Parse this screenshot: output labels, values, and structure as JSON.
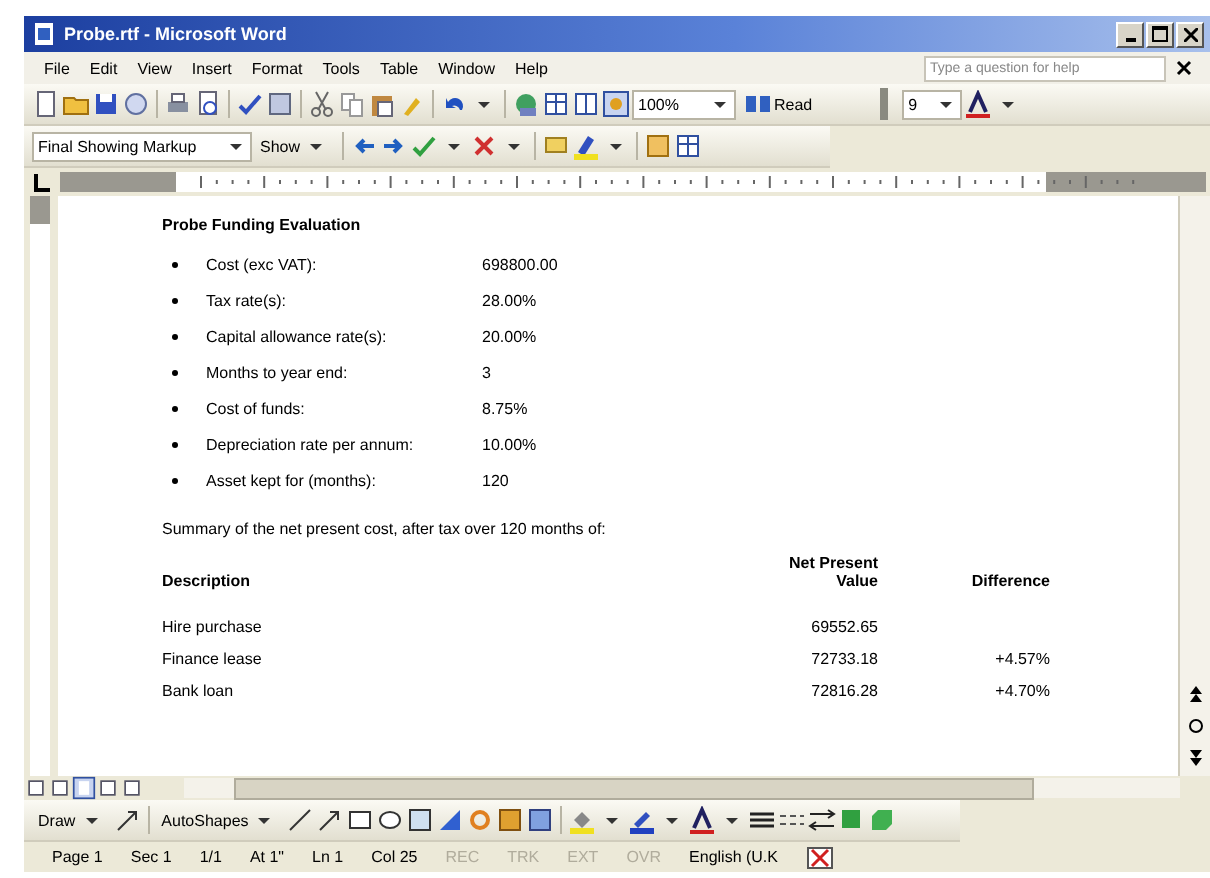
{
  "window": {
    "title": "Probe.rtf - Microsoft Word"
  },
  "menu": [
    {
      "label": "File"
    },
    {
      "label": "Edit"
    },
    {
      "label": "View"
    },
    {
      "label": "Insert"
    },
    {
      "label": "Format"
    },
    {
      "label": "Tools"
    },
    {
      "label": "Table"
    },
    {
      "label": "Window"
    },
    {
      "label": "Help"
    }
  ],
  "help_search": {
    "placeholder": "Type a question for help"
  },
  "standard_toolbar": {
    "zoom": "100%",
    "read": "Read",
    "font_size": "9"
  },
  "reviewing_toolbar": {
    "display": "Final Showing Markup",
    "show": "Show"
  },
  "document": {
    "heading": "Probe Funding Evaluation",
    "bullets": [
      {
        "label": "Cost (exc VAT):",
        "value": "698800.00"
      },
      {
        "label": "Tax rate(s):",
        "value": "28.00%"
      },
      {
        "label": "Capital allowance rate(s):",
        "value": "20.00%"
      },
      {
        "label": "Months to year end:",
        "value": "3"
      },
      {
        "label": "Cost of funds:",
        "value": "8.75%"
      },
      {
        "label": "Depreciation rate per annum:",
        "value": "10.00%"
      },
      {
        "label": "Asset kept for (months):",
        "value": "120"
      }
    ],
    "summary": "Summary of the net present cost, after tax over 120 months of:",
    "table": {
      "columns": [
        "Description",
        "Net Present Value",
        "Difference"
      ],
      "rows": [
        [
          "Hire purchase",
          "69552.65",
          ""
        ],
        [
          "Finance lease",
          "72733.18",
          "+4.57%"
        ],
        [
          "Bank loan",
          "72816.28",
          "+4.70%"
        ]
      ]
    }
  },
  "drawing_toolbar": {
    "draw": "Draw",
    "autoshapes": "AutoShapes"
  },
  "status_bar": [
    {
      "text": "Page 1",
      "disabled": false
    },
    {
      "text": "Sec 1",
      "disabled": false
    },
    {
      "text": "1/1",
      "disabled": false
    },
    {
      "text": "At 1\"",
      "disabled": false
    },
    {
      "text": "Ln 1",
      "disabled": false
    },
    {
      "text": "Col 25",
      "disabled": false
    },
    {
      "text": "REC",
      "disabled": true
    },
    {
      "text": "TRK",
      "disabled": true
    },
    {
      "text": "EXT",
      "disabled": true
    },
    {
      "text": "OVR",
      "disabled": true
    },
    {
      "text": "English (U.K",
      "disabled": false
    }
  ]
}
